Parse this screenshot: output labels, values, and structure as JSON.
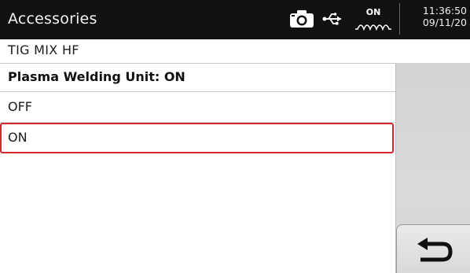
{
  "header": {
    "title": "Accessories",
    "arc_status": "ON",
    "time": "11:36:50",
    "date": "09/11/20",
    "icons": [
      "camera-icon",
      "usb-icon",
      "arc-wave-icon"
    ]
  },
  "subtitle": "TIG MIX HF",
  "list": {
    "header": "Plasma Welding Unit: ON",
    "items": [
      {
        "label": "OFF",
        "selected": false
      },
      {
        "label": "ON",
        "selected": true
      }
    ]
  },
  "side_panel": {
    "back_icon": "return-arrow-icon"
  },
  "colors": {
    "header_bg": "#111111",
    "selection_border": "#d0282e",
    "panel_bg": "#d6d6d6"
  }
}
